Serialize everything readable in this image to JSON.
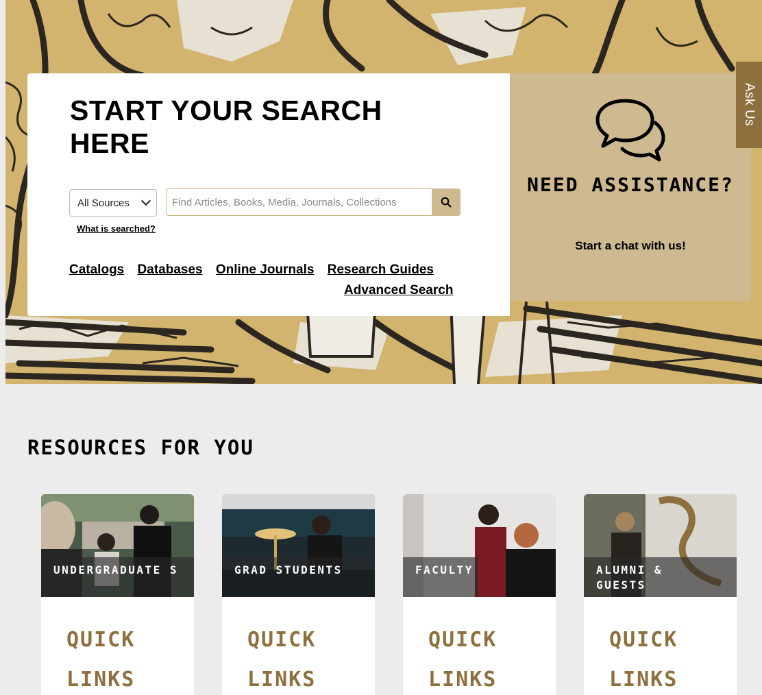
{
  "search": {
    "title": "START YOUR SEARCH HERE",
    "source_selected": "All Sources",
    "placeholder": "Find Articles, Books, Media, Journals, Collections",
    "what_searched": "What is searched?",
    "links": [
      "Catalogs",
      "Databases",
      "Online Journals",
      "Research Guides"
    ],
    "advanced": "Advanced Search"
  },
  "assist": {
    "title": "NEED ASSISTANCE?",
    "subtitle": "Start a chat with us!",
    "icon": "chat-bubbles-icon"
  },
  "ask_us": "Ask Us",
  "resources": {
    "title": "RESOURCES FOR YOU",
    "cards": [
      {
        "label": "UNDERGRADUATE S",
        "link": "QUICK LINKS"
      },
      {
        "label": "GRAD STUDENTS",
        "link": "QUICK LINKS"
      },
      {
        "label": "FACULTY",
        "link": "QUICK LINKS"
      },
      {
        "label": "ALUMNI & GUESTS",
        "link": "QUICK LINKS"
      }
    ]
  },
  "colors": {
    "gold": "#cfb991",
    "dark_gold": "#8e6f3e",
    "black": "#000000"
  }
}
